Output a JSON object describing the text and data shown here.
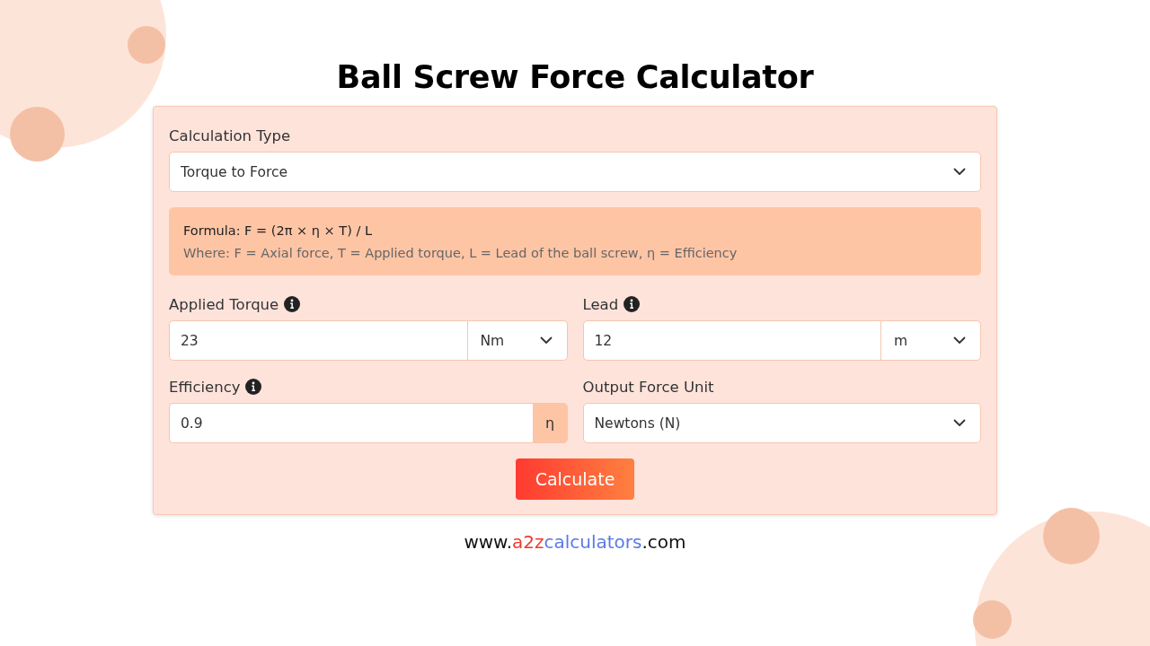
{
  "title": "Ball Screw Force Calculator",
  "calculation_type": {
    "label": "Calculation Type",
    "value": "Torque to Force"
  },
  "formula": {
    "formula": "Formula: F = (2π × η × T) / L",
    "where": "Where: F = Axial force, T = Applied torque, L = Lead of the ball screw, η = Efficiency"
  },
  "fields": [
    {
      "kind": "unit-select",
      "label": "Applied Torque",
      "info": true,
      "value": "23",
      "unit": "Nm"
    },
    {
      "kind": "unit-select",
      "label": "Lead",
      "info": true,
      "value": "12",
      "unit": "m"
    },
    {
      "kind": "unit-addon",
      "label": "Efficiency",
      "info": true,
      "value": "0.9",
      "unit": "η"
    },
    {
      "kind": "select",
      "label": "Output Force Unit",
      "info": false,
      "value": "Newtons (N)"
    }
  ],
  "button": "Calculate",
  "footer_url": [
    {
      "text": "www.",
      "color": "#111111"
    },
    {
      "text": "a2z",
      "color": "#f03a2e"
    },
    {
      "text": "calculators",
      "color": "#5b79e8"
    },
    {
      "text": ".com",
      "color": "#111111"
    }
  ]
}
